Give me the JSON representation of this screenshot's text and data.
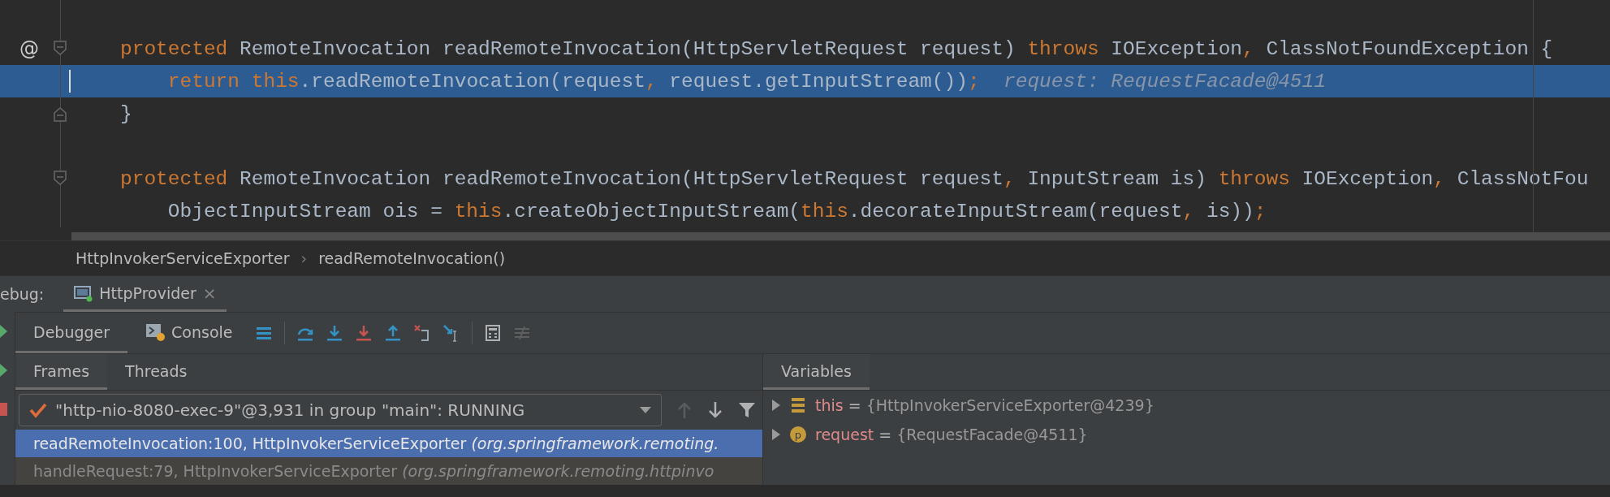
{
  "editor": {
    "lines": [
      {
        "highlighted": false
      },
      {
        "highlighted": false,
        "marker": "@",
        "fold_start": true,
        "tokens": [
          {
            "kind": "keyword",
            "text": "protected"
          },
          {
            "kind": "plain",
            "text": " RemoteInvocation readRemoteInvocation(HttpServletRequest request) "
          },
          {
            "kind": "keyword",
            "text": "throws"
          },
          {
            "kind": "plain",
            "text": " IOException"
          },
          {
            "kind": "keyword",
            "text": ","
          },
          {
            "kind": "plain",
            "text": " ClassNotFoundException {"
          }
        ]
      },
      {
        "highlighted": true,
        "tokens": [
          {
            "kind": "keyword",
            "text": "    return "
          },
          {
            "kind": "keyword",
            "text": "this"
          },
          {
            "kind": "plain",
            "text": ".readRemoteInvocation(request"
          },
          {
            "kind": "keyword",
            "text": ","
          },
          {
            "kind": "plain",
            "text": " request.getInputStream())"
          },
          {
            "kind": "keyword",
            "text": ";"
          },
          {
            "kind": "hint",
            "text": "  request: RequestFacade@4511"
          }
        ]
      },
      {
        "highlighted": false,
        "fold_end": true,
        "tokens": [
          {
            "kind": "plain",
            "text": "}"
          }
        ]
      },
      {
        "highlighted": false
      },
      {
        "highlighted": false,
        "fold_start": true,
        "tokens": [
          {
            "kind": "keyword",
            "text": "protected"
          },
          {
            "kind": "plain",
            "text": " RemoteInvocation readRemoteInvocation(HttpServletRequest request"
          },
          {
            "kind": "keyword",
            "text": ","
          },
          {
            "kind": "plain",
            "text": " InputStream is) "
          },
          {
            "kind": "keyword",
            "text": "throws"
          },
          {
            "kind": "plain",
            "text": " IOException"
          },
          {
            "kind": "keyword",
            "text": ","
          },
          {
            "kind": "plain",
            "text": " ClassNotFou"
          }
        ]
      },
      {
        "highlighted": false,
        "tokens": [
          {
            "kind": "plain",
            "text": "    ObjectInputStream ois = "
          },
          {
            "kind": "keyword",
            "text": "this"
          },
          {
            "kind": "plain",
            "text": ".createObjectInputStream("
          },
          {
            "kind": "keyword",
            "text": "this"
          },
          {
            "kind": "plain",
            "text": ".decorateInputStream(request"
          },
          {
            "kind": "keyword",
            "text": ","
          },
          {
            "kind": "plain",
            "text": " is))"
          },
          {
            "kind": "keyword",
            "text": ";"
          }
        ]
      }
    ]
  },
  "breadcrumb": {
    "items": [
      "HttpInvokerServiceExporter",
      "readRemoteInvocation()"
    ],
    "separator": "›"
  },
  "debug_bar": {
    "label": "ebug:",
    "tab": {
      "title": "HttpProvider",
      "close": "×",
      "selected": true
    }
  },
  "toolbar": {
    "tabs": [
      {
        "label": "Debugger",
        "selected": true,
        "icon": false
      },
      {
        "label": "Console",
        "selected": false,
        "icon": true
      }
    ]
  },
  "frames_panel": {
    "tabs": [
      {
        "label": "Frames",
        "selected": true
      },
      {
        "label": "Threads",
        "selected": false
      }
    ],
    "thread": "\"http-nio-8080-exec-9\"@3,931 in group \"main\": RUNNING",
    "frames": [
      {
        "method": "readRemoteInvocation:100, HttpInvokerServiceExporter ",
        "package": "(org.springframework.remoting.",
        "selected": true
      },
      {
        "method": "handleRequest:79, HttpInvokerServiceExporter ",
        "package": "(org.springframework.remoting.httpinvo",
        "selected": false
      }
    ]
  },
  "variables_panel": {
    "tabs": [
      {
        "label": "Variables",
        "selected": true
      }
    ],
    "variables": [
      {
        "kind": "field",
        "name": "this",
        "equals": "=",
        "value": "{HttpInvokerServiceExporter@4239}"
      },
      {
        "kind": "param",
        "icon_letter": "p",
        "name": "request",
        "equals": "=",
        "value": "{RequestFacade@4511}"
      }
    ]
  }
}
